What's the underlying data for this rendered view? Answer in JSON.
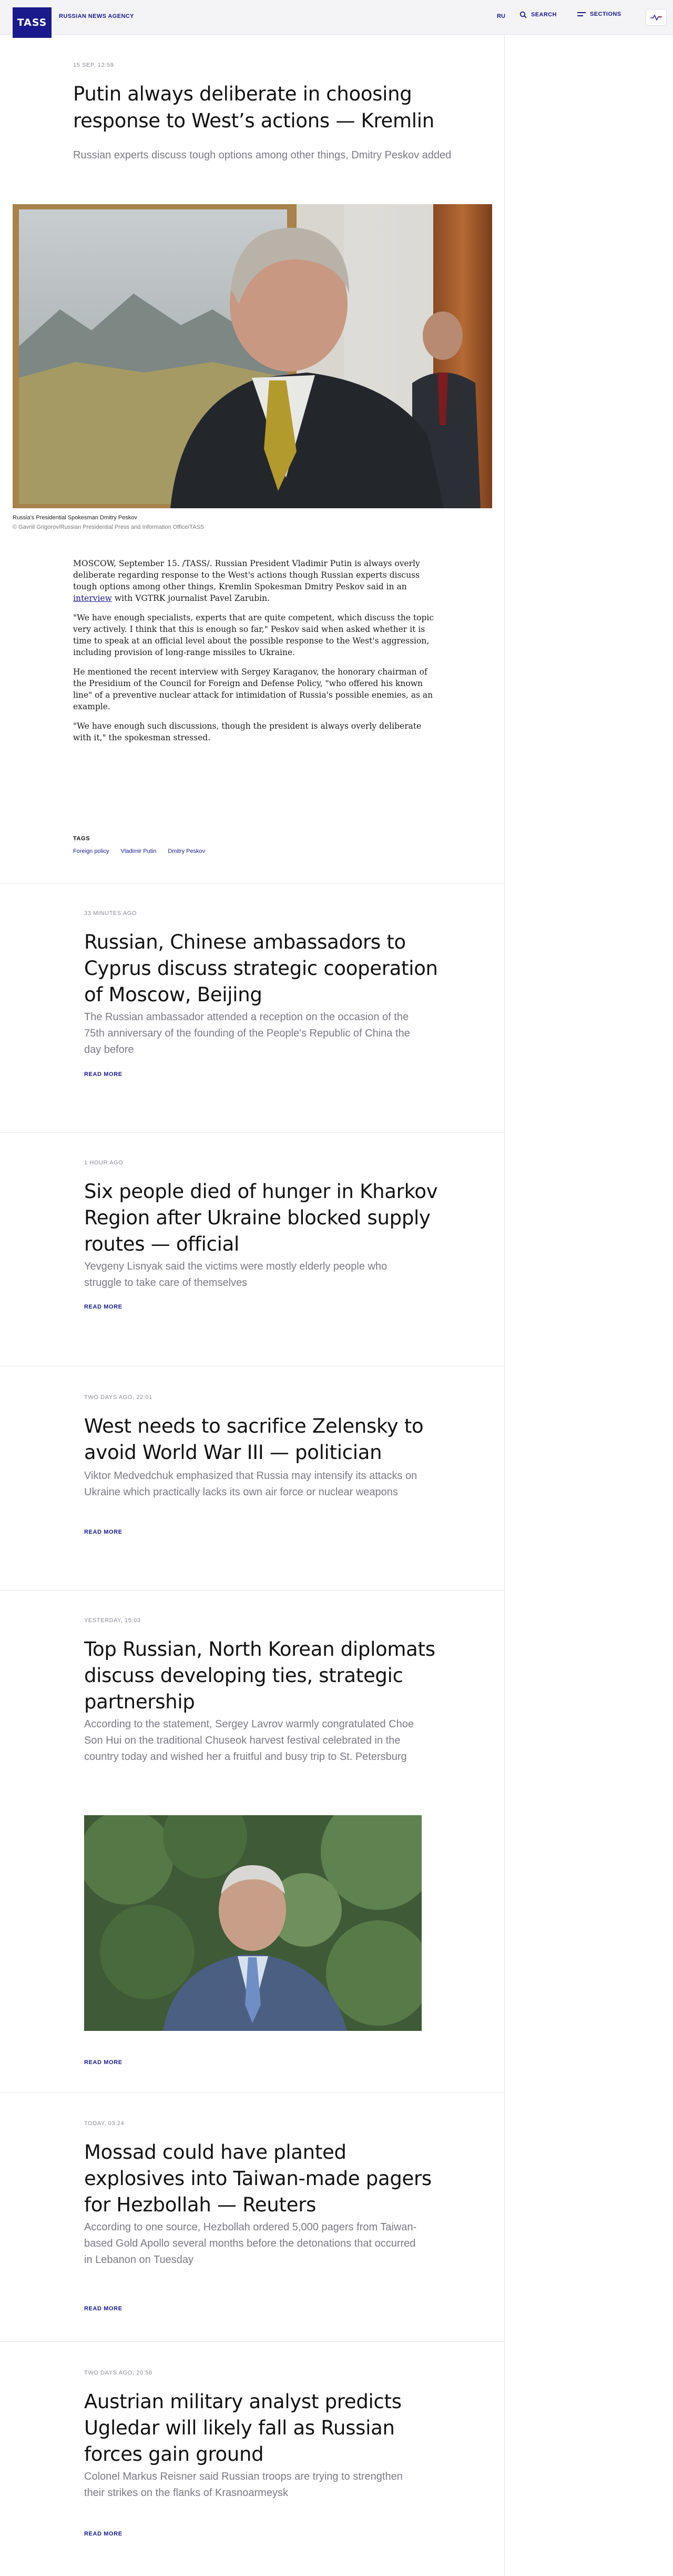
{
  "header": {
    "logo": "TASS",
    "agency": "RUSSIAN NEWS AGENCY",
    "lang": "RU",
    "search": "SEARCH",
    "sections": "SECTIONS"
  },
  "article": {
    "date": "15 SEP, 12:59",
    "title": "Putin always deliberate in choosing response to West’s actions — Kremlin",
    "lead": "Russian experts discuss tough options among other things, Dmitry Peskov added",
    "caption": "Russia's Presidential Spokesman Dmitry Peskov",
    "credit": "© Gavriil Grigorov/Russian Presidential Press and Information Office/TASS",
    "p1_before": "MOSCOW, September 15. /TASS/. Russian President Vladimir Putin is always overly deliberate regarding response to the West's actions though Russian experts discuss tough options among other things, Kremlin Spokesman Dmitry Peskov said in an ",
    "p1_link": "interview",
    "p1_after": " with VGTRK journalist Pavel Zarubin.",
    "p2": "\"We have enough specialists, experts that are quite competent, which discuss the topic very actively. I think that this is enough so far,\" Peskov said when asked whether it is time to speak at an official level about the possible response to the West's aggression, including provision of long-range missiles to Ukraine.",
    "p3": "He mentioned the recent interview with Sergey Karaganov, the honorary chairman of the Presidium of the Council for Foreign and Defense Policy, \"who offered his known line\" of a preventive nuclear attack for intimidation of Russia's possible enemies, as an example.",
    "p4": "\"We have enough such discussions, though the president is always overly deliberate with it,\" the spokesman stressed.",
    "tags_label": "TAGS",
    "tags": [
      "Foreign policy",
      "Vladimir Putin",
      "Dmitry Peskov"
    ]
  },
  "related": [
    {
      "date": "33 MINUTES AGO",
      "title": "Russian, Chinese ambassadors to Cyprus discuss strategic cooperation of Moscow, Beijing",
      "lead": "The Russian ambassador attended a reception on the occasion of the 75th anniversary of the founding of the People's Republic of China the day before",
      "read": "READ MORE"
    },
    {
      "date": "1 HOUR AGO",
      "title": "Six people died of hunger in Kharkov Region after Ukraine blocked supply routes — official",
      "lead": "Yevgeny Lisnyak said the victims were mostly elderly people who struggle to take care of themselves",
      "read": "READ MORE"
    },
    {
      "date": "TWO DAYS AGO, 22:01",
      "title": "West needs to sacrifice Zelensky to avoid World War III — politician",
      "lead": "Viktor Medvedchuk emphasized that Russia may intensify its attacks on Ukraine which practically lacks its own air force or nuclear weapons",
      "read": "READ MORE"
    },
    {
      "date": "YESTERDAY, 15:03",
      "title": "Top Russian, North Korean diplomats discuss developing ties, strategic partnership",
      "lead": "According to the statement, Sergey Lavrov warmly congratulated Choe Son Hui on the traditional Chuseok harvest festival celebrated in the country today and wished her a fruitful and busy trip to St. Petersburg",
      "read": "READ MORE"
    },
    {
      "date": "TODAY, 03:24",
      "title": "Mossad could have planted explosives into Taiwan-made pagers for Hezbollah — Reuters",
      "lead": "According to one source, Hezbollah ordered 5,000 pagers from Taiwan-based Gold Apollo several months before the detonations that occurred in Lebanon on Tuesday",
      "read": "READ MORE"
    },
    {
      "date": "TWO DAYS AGO, 20:56",
      "title": "Austrian military analyst predicts Ugledar will likely fall as Russian forces gain ground",
      "lead": "Colonel Markus Reisner said Russian troops are trying to strengthen their strikes on the flanks of Krasnoarmeysk",
      "read": "READ MORE"
    }
  ],
  "colors": {
    "brand": "#1a1a8c",
    "muted": "#7a7a84"
  }
}
